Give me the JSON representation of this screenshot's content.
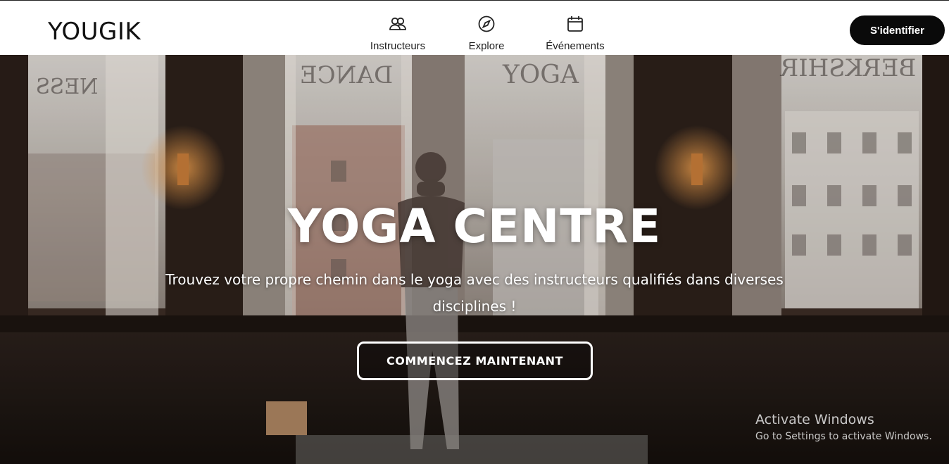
{
  "header": {
    "logo": "YOUGIK",
    "nav": [
      {
        "label": "Instructeurs",
        "icon": "people-icon"
      },
      {
        "label": "Explore",
        "icon": "compass-icon"
      },
      {
        "label": "Événements",
        "icon": "calendar-icon"
      }
    ],
    "signin_label": "S'identifier"
  },
  "hero": {
    "title": "YOGA CENTRE",
    "subtitle": "Trouvez votre propre chemin dans le yoga avec des instructeurs qualifiés dans diverses disciplines !",
    "cta_label": "COMMENCEZ MAINTENANT",
    "window_signs": [
      "NESS",
      "DANCE",
      "YOGA",
      "BERKSHIR"
    ]
  },
  "system": {
    "activate_title": "Activate Windows",
    "activate_sub": "Go to Settings to activate Windows."
  },
  "colors": {
    "header_bg": "#ffffff",
    "button_bg": "#0a0a0a",
    "text_light": "#ffffff"
  }
}
